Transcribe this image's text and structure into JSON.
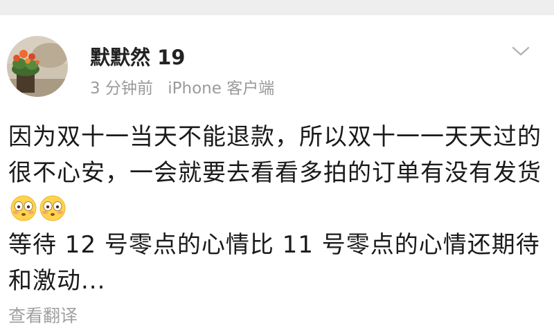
{
  "post": {
    "username": "默默然 19",
    "time": "3 分钟前",
    "source": "iPhone 客户端",
    "lines": [
      "因为双十一当天不能退款，所以双十一一天天过的很不心安，一会就要去看看多拍的订单有没有发货",
      "等待 12 号零点的心情比 11 号零点的心情还期待和激动..."
    ],
    "emojis": [
      "flushed-face-emoji",
      "flushed-face-emoji"
    ],
    "translate_label": "查看翻译"
  },
  "icons": {
    "menu": "chevron-down-icon"
  },
  "colors": {
    "username": "#222222",
    "meta": "#9a9a9a",
    "text": "#1a1a1a",
    "translate": "#a0a0a0"
  }
}
